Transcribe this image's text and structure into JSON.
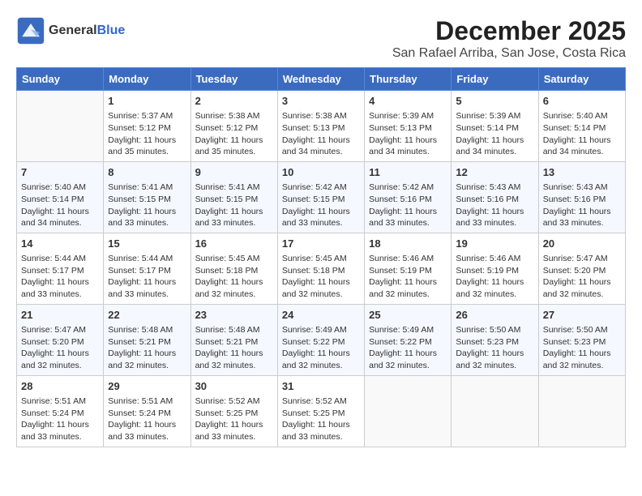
{
  "header": {
    "logo_general": "General",
    "logo_blue": "Blue",
    "month_title": "December 2025",
    "location": "San Rafael Arriba, San Jose, Costa Rica"
  },
  "calendar": {
    "headers": [
      "Sunday",
      "Monday",
      "Tuesday",
      "Wednesday",
      "Thursday",
      "Friday",
      "Saturday"
    ],
    "weeks": [
      [
        {
          "day": "",
          "sunrise": "",
          "sunset": "",
          "daylight": ""
        },
        {
          "day": "1",
          "sunrise": "Sunrise: 5:37 AM",
          "sunset": "Sunset: 5:12 PM",
          "daylight": "Daylight: 11 hours and 35 minutes."
        },
        {
          "day": "2",
          "sunrise": "Sunrise: 5:38 AM",
          "sunset": "Sunset: 5:12 PM",
          "daylight": "Daylight: 11 hours and 35 minutes."
        },
        {
          "day": "3",
          "sunrise": "Sunrise: 5:38 AM",
          "sunset": "Sunset: 5:13 PM",
          "daylight": "Daylight: 11 hours and 34 minutes."
        },
        {
          "day": "4",
          "sunrise": "Sunrise: 5:39 AM",
          "sunset": "Sunset: 5:13 PM",
          "daylight": "Daylight: 11 hours and 34 minutes."
        },
        {
          "day": "5",
          "sunrise": "Sunrise: 5:39 AM",
          "sunset": "Sunset: 5:14 PM",
          "daylight": "Daylight: 11 hours and 34 minutes."
        },
        {
          "day": "6",
          "sunrise": "Sunrise: 5:40 AM",
          "sunset": "Sunset: 5:14 PM",
          "daylight": "Daylight: 11 hours and 34 minutes."
        }
      ],
      [
        {
          "day": "7",
          "sunrise": "Sunrise: 5:40 AM",
          "sunset": "Sunset: 5:14 PM",
          "daylight": "Daylight: 11 hours and 34 minutes."
        },
        {
          "day": "8",
          "sunrise": "Sunrise: 5:41 AM",
          "sunset": "Sunset: 5:15 PM",
          "daylight": "Daylight: 11 hours and 33 minutes."
        },
        {
          "day": "9",
          "sunrise": "Sunrise: 5:41 AM",
          "sunset": "Sunset: 5:15 PM",
          "daylight": "Daylight: 11 hours and 33 minutes."
        },
        {
          "day": "10",
          "sunrise": "Sunrise: 5:42 AM",
          "sunset": "Sunset: 5:15 PM",
          "daylight": "Daylight: 11 hours and 33 minutes."
        },
        {
          "day": "11",
          "sunrise": "Sunrise: 5:42 AM",
          "sunset": "Sunset: 5:16 PM",
          "daylight": "Daylight: 11 hours and 33 minutes."
        },
        {
          "day": "12",
          "sunrise": "Sunrise: 5:43 AM",
          "sunset": "Sunset: 5:16 PM",
          "daylight": "Daylight: 11 hours and 33 minutes."
        },
        {
          "day": "13",
          "sunrise": "Sunrise: 5:43 AM",
          "sunset": "Sunset: 5:16 PM",
          "daylight": "Daylight: 11 hours and 33 minutes."
        }
      ],
      [
        {
          "day": "14",
          "sunrise": "Sunrise: 5:44 AM",
          "sunset": "Sunset: 5:17 PM",
          "daylight": "Daylight: 11 hours and 33 minutes."
        },
        {
          "day": "15",
          "sunrise": "Sunrise: 5:44 AM",
          "sunset": "Sunset: 5:17 PM",
          "daylight": "Daylight: 11 hours and 33 minutes."
        },
        {
          "day": "16",
          "sunrise": "Sunrise: 5:45 AM",
          "sunset": "Sunset: 5:18 PM",
          "daylight": "Daylight: 11 hours and 32 minutes."
        },
        {
          "day": "17",
          "sunrise": "Sunrise: 5:45 AM",
          "sunset": "Sunset: 5:18 PM",
          "daylight": "Daylight: 11 hours and 32 minutes."
        },
        {
          "day": "18",
          "sunrise": "Sunrise: 5:46 AM",
          "sunset": "Sunset: 5:19 PM",
          "daylight": "Daylight: 11 hours and 32 minutes."
        },
        {
          "day": "19",
          "sunrise": "Sunrise: 5:46 AM",
          "sunset": "Sunset: 5:19 PM",
          "daylight": "Daylight: 11 hours and 32 minutes."
        },
        {
          "day": "20",
          "sunrise": "Sunrise: 5:47 AM",
          "sunset": "Sunset: 5:20 PM",
          "daylight": "Daylight: 11 hours and 32 minutes."
        }
      ],
      [
        {
          "day": "21",
          "sunrise": "Sunrise: 5:47 AM",
          "sunset": "Sunset: 5:20 PM",
          "daylight": "Daylight: 11 hours and 32 minutes."
        },
        {
          "day": "22",
          "sunrise": "Sunrise: 5:48 AM",
          "sunset": "Sunset: 5:21 PM",
          "daylight": "Daylight: 11 hours and 32 minutes."
        },
        {
          "day": "23",
          "sunrise": "Sunrise: 5:48 AM",
          "sunset": "Sunset: 5:21 PM",
          "daylight": "Daylight: 11 hours and 32 minutes."
        },
        {
          "day": "24",
          "sunrise": "Sunrise: 5:49 AM",
          "sunset": "Sunset: 5:22 PM",
          "daylight": "Daylight: 11 hours and 32 minutes."
        },
        {
          "day": "25",
          "sunrise": "Sunrise: 5:49 AM",
          "sunset": "Sunset: 5:22 PM",
          "daylight": "Daylight: 11 hours and 32 minutes."
        },
        {
          "day": "26",
          "sunrise": "Sunrise: 5:50 AM",
          "sunset": "Sunset: 5:23 PM",
          "daylight": "Daylight: 11 hours and 32 minutes."
        },
        {
          "day": "27",
          "sunrise": "Sunrise: 5:50 AM",
          "sunset": "Sunset: 5:23 PM",
          "daylight": "Daylight: 11 hours and 32 minutes."
        }
      ],
      [
        {
          "day": "28",
          "sunrise": "Sunrise: 5:51 AM",
          "sunset": "Sunset: 5:24 PM",
          "daylight": "Daylight: 11 hours and 33 minutes."
        },
        {
          "day": "29",
          "sunrise": "Sunrise: 5:51 AM",
          "sunset": "Sunset: 5:24 PM",
          "daylight": "Daylight: 11 hours and 33 minutes."
        },
        {
          "day": "30",
          "sunrise": "Sunrise: 5:52 AM",
          "sunset": "Sunset: 5:25 PM",
          "daylight": "Daylight: 11 hours and 33 minutes."
        },
        {
          "day": "31",
          "sunrise": "Sunrise: 5:52 AM",
          "sunset": "Sunset: 5:25 PM",
          "daylight": "Daylight: 11 hours and 33 minutes."
        },
        {
          "day": "",
          "sunrise": "",
          "sunset": "",
          "daylight": ""
        },
        {
          "day": "",
          "sunrise": "",
          "sunset": "",
          "daylight": ""
        },
        {
          "day": "",
          "sunrise": "",
          "sunset": "",
          "daylight": ""
        }
      ]
    ]
  }
}
